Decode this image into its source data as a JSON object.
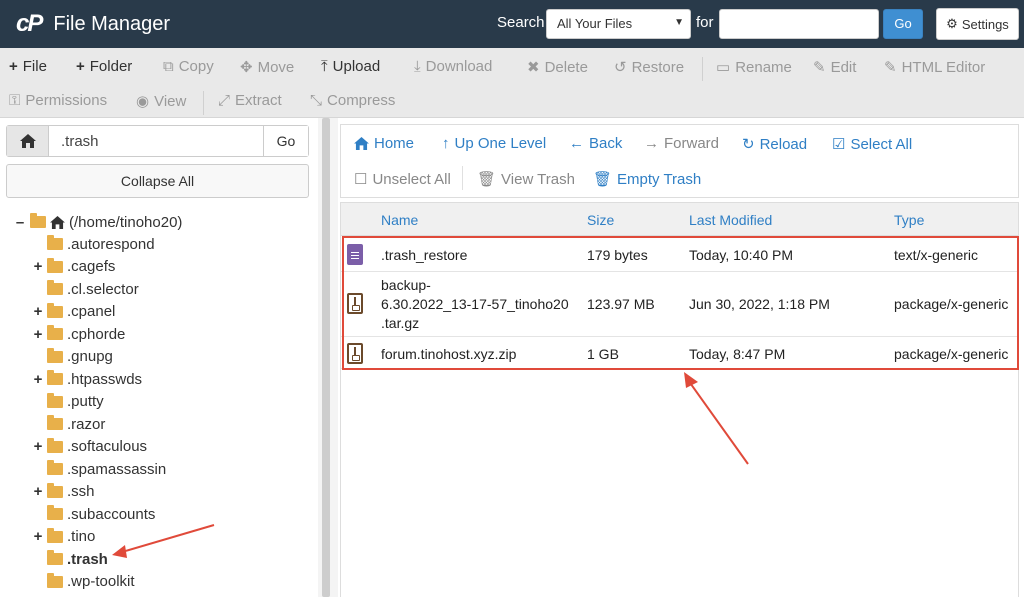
{
  "header": {
    "app_title": "File Manager",
    "search_label": "Search",
    "search_scope": "All Your Files",
    "for_label": "for",
    "search_value": "",
    "go_label": "Go",
    "settings_label": "Settings"
  },
  "toolbar": {
    "file": "File",
    "folder": "Folder",
    "copy": "Copy",
    "move": "Move",
    "upload": "Upload",
    "download": "Download",
    "delete": "Delete",
    "restore": "Restore",
    "rename": "Rename",
    "edit": "Edit",
    "html_editor": "HTML Editor",
    "permissions": "Permissions",
    "view": "View",
    "extract": "Extract",
    "compress": "Compress"
  },
  "sidebar": {
    "path_value": ".trash",
    "go_label": "Go",
    "collapse_label": "Collapse All",
    "root": "(/home/tinoho20)",
    "folders": [
      {
        "label": ".autorespond",
        "expandable": false
      },
      {
        "label": ".cagefs",
        "expandable": true
      },
      {
        "label": ".cl.selector",
        "expandable": false
      },
      {
        "label": ".cpanel",
        "expandable": true
      },
      {
        "label": ".cphorde",
        "expandable": true
      },
      {
        "label": ".gnupg",
        "expandable": false
      },
      {
        "label": ".htpasswds",
        "expandable": true
      },
      {
        "label": ".putty",
        "expandable": false
      },
      {
        "label": ".razor",
        "expandable": false
      },
      {
        "label": ".softaculous",
        "expandable": true
      },
      {
        "label": ".spamassassin",
        "expandable": false
      },
      {
        "label": ".ssh",
        "expandable": true
      },
      {
        "label": ".subaccounts",
        "expandable": false
      },
      {
        "label": ".tino",
        "expandable": true
      },
      {
        "label": ".trash",
        "expandable": false,
        "selected": true
      },
      {
        "label": ".wp-toolkit",
        "expandable": false
      }
    ]
  },
  "nav": {
    "home": "Home",
    "up_one_level": "Up One Level",
    "back": "Back",
    "forward": "Forward",
    "reload": "Reload",
    "select_all": "Select All",
    "unselect_all": "Unselect All",
    "view_trash": "View Trash",
    "empty_trash": "Empty Trash"
  },
  "table": {
    "columns": {
      "name": "Name",
      "size": "Size",
      "modified": "Last Modified",
      "type": "Type"
    },
    "rows": [
      {
        "name_lines": [
          ".trash_restore"
        ],
        "size": "179 bytes",
        "modified": "Today, 10:40 PM",
        "type": "text/x-generic",
        "icon": "generic-file-icon"
      },
      {
        "name_lines": [
          "backup-",
          "6.30.2022_13-17-57_tinoho20",
          ".tar.gz"
        ],
        "size": "123.97 MB",
        "modified": "Jun 30, 2022, 1:18 PM",
        "type": "package/x-generic",
        "icon": "archive-file-icon"
      },
      {
        "name_lines": [
          "forum.tinohost.xyz.zip"
        ],
        "size": "1 GB",
        "modified": "Today, 8:47 PM",
        "type": "package/x-generic",
        "icon": "archive-file-icon"
      }
    ]
  },
  "colors": {
    "header_bg": "#293a4a",
    "accent_blue": "#2f7fc5",
    "annotation_red": "#e04a3a",
    "folder_yellow": "#e8b04a"
  }
}
